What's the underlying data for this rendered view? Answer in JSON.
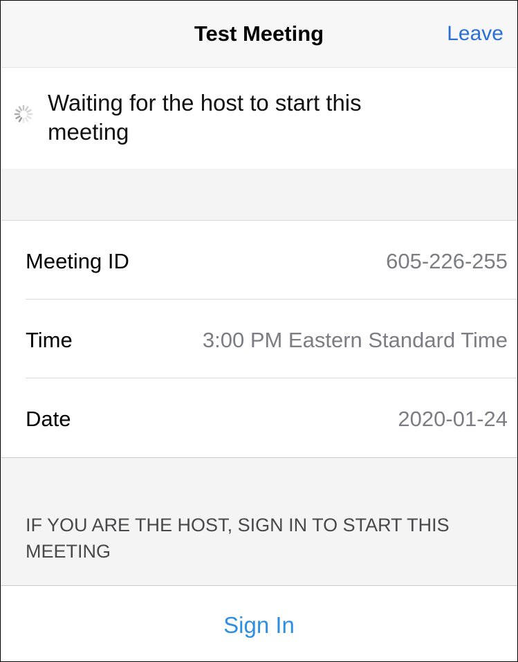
{
  "navbar": {
    "title": "Test Meeting",
    "leave_label": "Leave"
  },
  "waiting": {
    "message": "Waiting for the host to start this meeting",
    "icon": "loading-spinner-icon"
  },
  "details": {
    "rows": [
      {
        "label": "Meeting ID",
        "value": "605-226-255"
      },
      {
        "label": "Time",
        "value": "3:00 PM Eastern Standard Time"
      },
      {
        "label": "Date",
        "value": "2020-01-24"
      }
    ]
  },
  "host": {
    "note": "IF YOU ARE THE HOST, SIGN IN TO START THIS MEETING"
  },
  "signin": {
    "label": "Sign In"
  },
  "colors": {
    "link_blue": "#2a6fd6",
    "signin_blue": "#2e8fe0",
    "value_gray": "#7c7c84",
    "section_gray": "#f4f4f4"
  }
}
